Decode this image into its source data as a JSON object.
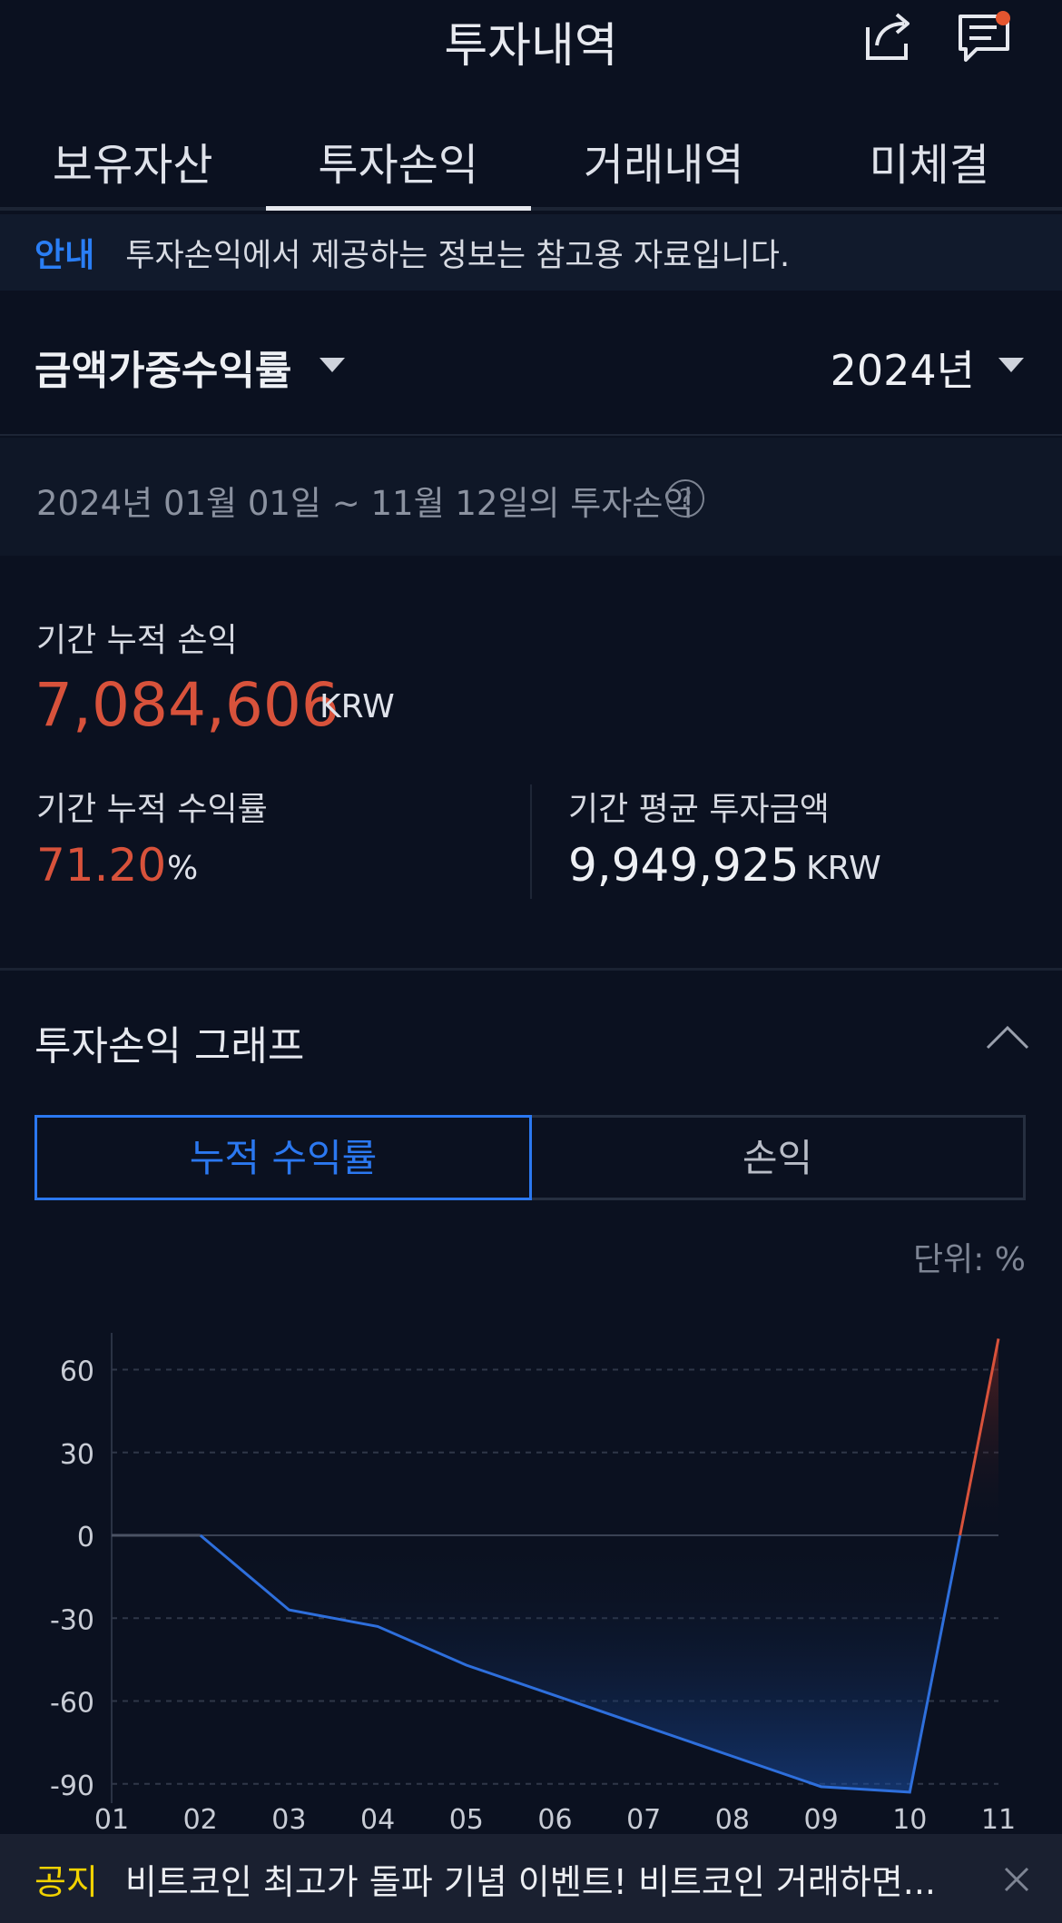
{
  "header": {
    "title": "투자내역",
    "share_icon": "share-icon",
    "chat_icon": "chat-icon"
  },
  "tabs": [
    {
      "label": "보유자산"
    },
    {
      "label": "투자손익"
    },
    {
      "label": "거래내역"
    },
    {
      "label": "미체결"
    }
  ],
  "active_tab": "투자손익",
  "notice": {
    "tag": "안내",
    "text": "투자손익에서 제공하는 정보는 참고용 자료입니다."
  },
  "filter": {
    "metric": "금액가중수익률",
    "year": "2024년"
  },
  "period": {
    "text": "2024년 01월 01일 ~ 11월 12일의 투자손익"
  },
  "summary": {
    "profit_label": "기간 누적 손익",
    "profit_value": "7,084,606",
    "currency": "KRW",
    "rate_label": "기간 누적 수익률",
    "rate_value": "71.20",
    "rate_unit": "%",
    "avg_label": "기간 평균 투자금액",
    "avg_value": "9,949,925"
  },
  "graph": {
    "title": "투자손익 그래프",
    "seg_active": "누적 수익률",
    "seg_inactive": "손익",
    "unit": "단위: %"
  },
  "chart_data": {
    "type": "area",
    "x": [
      "01",
      "02",
      "03",
      "04",
      "05",
      "06",
      "07",
      "08",
      "09",
      "10",
      "11"
    ],
    "values": [
      0,
      0,
      -27,
      -33,
      -47,
      -58,
      -69,
      -80,
      -91,
      -93,
      71.2
    ],
    "yticks": [
      60,
      30,
      0,
      -30,
      -60,
      -90
    ],
    "ylim": [
      -95,
      72
    ],
    "grid": true,
    "colors": {
      "negative": "#2e6fdc",
      "positive": "#d8523b"
    }
  },
  "bottom_notice": {
    "tag": "공지",
    "text": "비트코인 최고가 돌파 기념 이벤트! 비트코인 거래하면..."
  },
  "colors": {
    "background": "#0b1120",
    "accent_blue": "#2b78f0",
    "accent_red": "#d8523b",
    "notice_yellow": "#f1d200"
  }
}
